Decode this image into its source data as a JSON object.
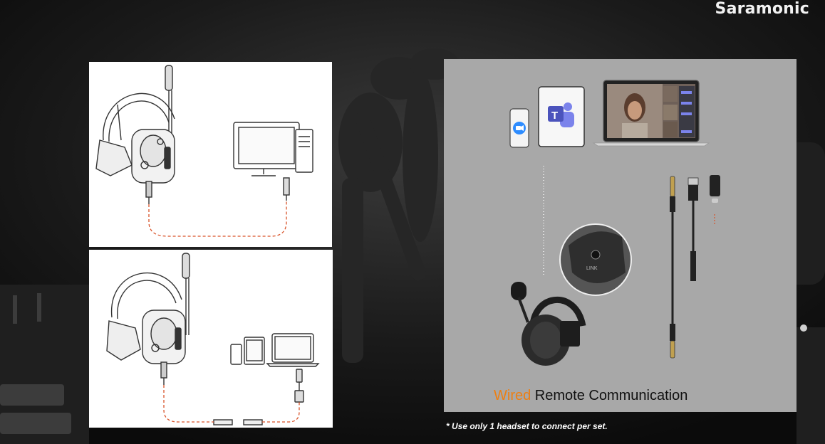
{
  "brand": {
    "name": "Saramonic"
  },
  "caption": {
    "highlight": "Wired",
    "rest": " Remote Communication"
  },
  "note": "* Use only 1 headset to connect per set.",
  "colors": {
    "highlight": "#ee7f12",
    "panel_gray": "#a8a8a8",
    "cable_dash": "#d9542b"
  },
  "icons": [
    "zoom-icon",
    "teams-icon"
  ]
}
